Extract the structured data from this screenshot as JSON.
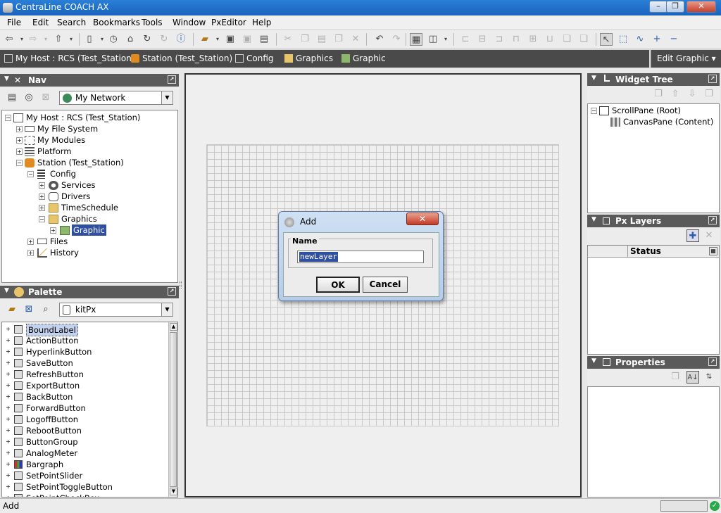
{
  "window": {
    "title": "CentraLine COACH AX",
    "min": "–",
    "max": "❐",
    "close": "✕"
  },
  "menu": [
    "File",
    "Edit",
    "Search",
    "Bookmarks",
    "Tools",
    "Window",
    "PxEditor",
    "Help"
  ],
  "breadcrumbs": [
    "My Host : RCS (Test_Station)",
    "Station (Test_Station)",
    "Config",
    "Graphics",
    "Graphic"
  ],
  "edit_mode": "Edit Graphic",
  "nav": {
    "title": "Nav",
    "network": "My Network",
    "tree": [
      "My Host : RCS (Test_Station)",
      "My File System",
      "My Modules",
      "Platform",
      "Station (Test_Station)",
      "Config",
      "Services",
      "Drivers",
      "TimeSchedule",
      "Graphics",
      "Graphic",
      "Files",
      "History"
    ]
  },
  "palette": {
    "title": "Palette",
    "module": "kitPx",
    "items": [
      "BoundLabel",
      "ActionButton",
      "HyperlinkButton",
      "SaveButton",
      "RefreshButton",
      "ExportButton",
      "BackButton",
      "ForwardButton",
      "LogoffButton",
      "RebootButton",
      "ButtonGroup",
      "AnalogMeter",
      "Bargraph",
      "SetPointSlider",
      "SetPointToggleButton",
      "SetPointCheckBox"
    ]
  },
  "widget_tree": {
    "title": "Widget Tree",
    "items": [
      "ScrollPane (Root)",
      "CanvasPane (Content)"
    ]
  },
  "px_layers": {
    "title": "Px Layers",
    "column": "Status"
  },
  "properties": {
    "title": "Properties"
  },
  "dialog": {
    "title": "Add",
    "group": "Name",
    "value": "newLayer",
    "ok": "OK",
    "cancel": "Cancel"
  },
  "status": "Add"
}
